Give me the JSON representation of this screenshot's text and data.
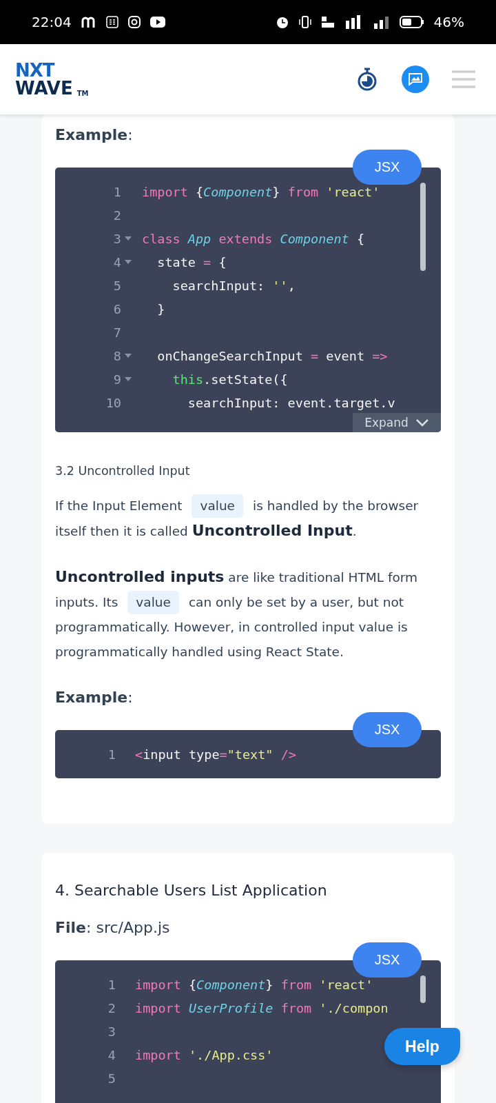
{
  "status_bar": {
    "time": "22:04",
    "battery": "46%"
  },
  "header": {
    "logo_top": "NXT",
    "logo_bottom": "WAVE",
    "logo_mark": "TM"
  },
  "cards": [
    {
      "blocks": [
        {
          "kind": "heading",
          "text": "**Example**:"
        },
        {
          "kind": "code",
          "language": "JSX",
          "expandable": true,
          "expand_label": "Expand",
          "scrollbar": true,
          "lines": [
            {
              "n": "1",
              "fold": false,
              "tokens": [
                {
                  "kind": "kw",
                  "t": "import "
                },
                {
                  "kind": "pl",
                  "t": "{"
                },
                {
                  "kind": "cls",
                  "t": "Component"
                },
                {
                  "kind": "pl",
                  "t": "} "
                },
                {
                  "kind": "kw",
                  "t": "from "
                },
                {
                  "kind": "str",
                  "t": "'react'"
                }
              ]
            },
            {
              "n": "2",
              "fold": false
            },
            {
              "n": "3",
              "fold": true,
              "tokens": [
                {
                  "kind": "kw",
                  "t": "class "
                },
                {
                  "kind": "cls",
                  "t": "App "
                },
                {
                  "kind": "kw",
                  "t": "extends "
                },
                {
                  "kind": "cls",
                  "t": "Component "
                },
                {
                  "kind": "pl",
                  "t": "{"
                }
              ]
            },
            {
              "n": "4",
              "fold": true,
              "tokens": [
                {
                  "kind": "pl",
                  "t": "  state "
                },
                {
                  "kind": "kw",
                  "t": "="
                },
                {
                  "kind": "pl",
                  "t": " {"
                }
              ]
            },
            {
              "n": "5",
              "fold": false,
              "tokens": [
                {
                  "kind": "pl",
                  "t": "    searchInput: "
                },
                {
                  "kind": "str",
                  "t": "''"
                },
                {
                  "kind": "pl",
                  "t": ","
                }
              ]
            },
            {
              "n": "6",
              "fold": false,
              "tokens": [
                {
                  "kind": "pl",
                  "t": "  }"
                }
              ]
            },
            {
              "n": "7",
              "fold": false
            },
            {
              "n": "8",
              "fold": true,
              "tokens": [
                {
                  "kind": "pl",
                  "t": "  onChangeSearchInput "
                },
                {
                  "kind": "kw",
                  "t": "="
                },
                {
                  "kind": "pl",
                  "t": " event "
                },
                {
                  "kind": "kw",
                  "t": "=>"
                }
              ]
            },
            {
              "n": "9",
              "fold": true,
              "tokens": [
                {
                  "kind": "this",
                  "t": "    this"
                },
                {
                  "kind": "pl",
                  "t": ".setState({"
                }
              ]
            },
            {
              "n": "10",
              "fold": false,
              "tokens": [
                {
                  "kind": "pl",
                  "t": "      searchInput: event.target.v"
                }
              ]
            }
          ]
        },
        {
          "kind": "subheading",
          "text": "3.2 Uncontrolled Input"
        },
        {
          "kind": "paragraph",
          "segments": [
            {
              "kind": "text",
              "text": "If the Input Element"
            },
            {
              "kind": "code",
              "text": "value"
            },
            {
              "kind": "text",
              "text": "is handled by the browser itself then it is called **Uncontrolled Input**."
            }
          ]
        },
        {
          "kind": "paragraph",
          "segments": [
            {
              "kind": "text",
              "text": "**Uncontrolled inputs** are like traditional HTML form inputs. Its"
            },
            {
              "kind": "code",
              "text": "value"
            },
            {
              "kind": "text",
              "text": "can only be set by a user, but not programmatically. However, in controlled input value is programmatically handled using React State."
            }
          ]
        },
        {
          "kind": "heading",
          "text": "**Example**:"
        },
        {
          "kind": "code",
          "language": "JSX",
          "lines": [
            {
              "n": "1",
              "fold": false,
              "tokens": [
                {
                  "kind": "kw",
                  "t": "<"
                },
                {
                  "kind": "pl",
                  "t": "input type"
                },
                {
                  "kind": "kw",
                  "t": "="
                },
                {
                  "kind": "str",
                  "t": "\"text\""
                },
                {
                  "kind": "kw",
                  "t": " />"
                }
              ]
            }
          ]
        }
      ]
    },
    {
      "blocks": [
        {
          "kind": "title",
          "text": "4. Searchable Users List Application"
        },
        {
          "kind": "heading",
          "text": "**File**: src/App.js"
        },
        {
          "kind": "code",
          "language": "JSX",
          "scrollbar": true,
          "lines": [
            {
              "n": "1",
              "fold": false,
              "tokens": [
                {
                  "kind": "kw",
                  "t": "import "
                },
                {
                  "kind": "pl",
                  "t": "{"
                },
                {
                  "kind": "cls",
                  "t": "Component"
                },
                {
                  "kind": "pl",
                  "t": "} "
                },
                {
                  "kind": "kw",
                  "t": "from "
                },
                {
                  "kind": "str",
                  "t": "'react'"
                }
              ]
            },
            {
              "n": "2",
              "fold": false,
              "tokens": [
                {
                  "kind": "kw",
                  "t": "import "
                },
                {
                  "kind": "cls",
                  "t": "UserProfile "
                },
                {
                  "kind": "kw",
                  "t": "from "
                },
                {
                  "kind": "str",
                  "t": "'./compon"
                }
              ]
            },
            {
              "n": "3",
              "fold": false
            },
            {
              "n": "4",
              "fold": false,
              "tokens": [
                {
                  "kind": "kw",
                  "t": "import "
                },
                {
                  "kind": "str",
                  "t": "'./App.css'"
                }
              ]
            },
            {
              "n": "5",
              "fold": false
            }
          ]
        }
      ]
    }
  ],
  "help_button": "Help"
}
